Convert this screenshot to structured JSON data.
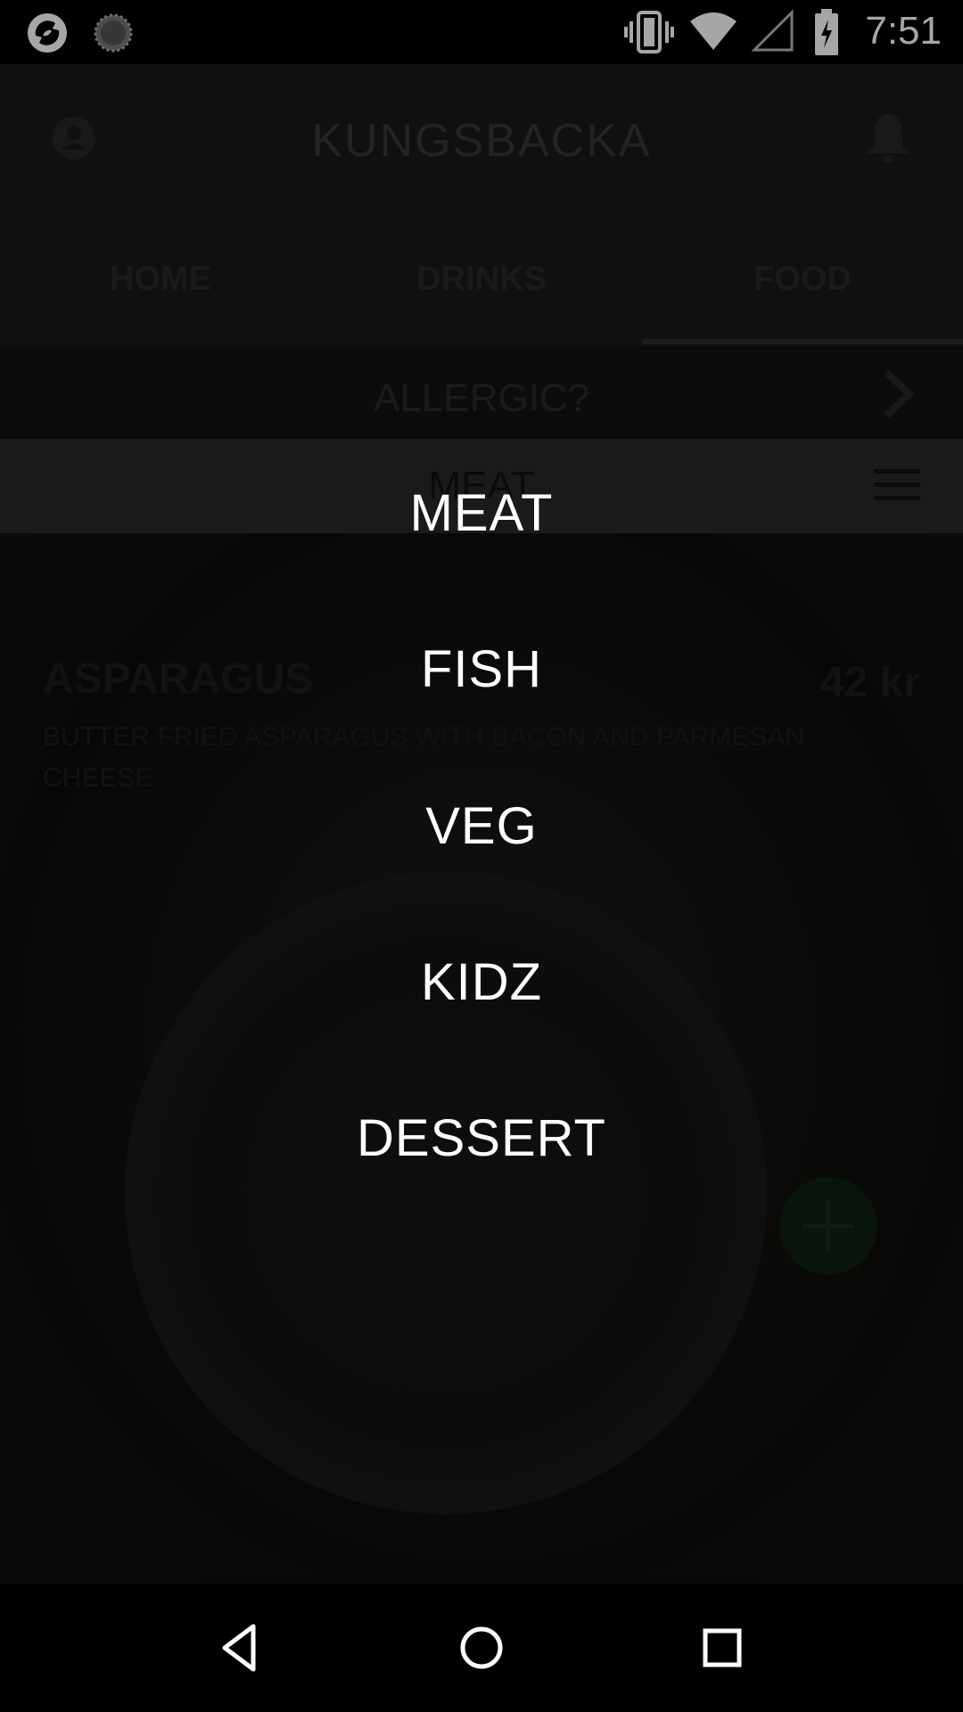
{
  "status_bar": {
    "time": "7:51",
    "icons": [
      "app-logo-icon",
      "loading-spinner-icon",
      "vibrate-icon",
      "wifi-icon",
      "cell-signal-icon",
      "battery-charging-icon"
    ]
  },
  "app": {
    "title": "KUNGSBACKA",
    "tabs": [
      {
        "label": "HOME"
      },
      {
        "label": "DRINKS"
      },
      {
        "label": "FOOD"
      }
    ],
    "active_tab": "FOOD",
    "allergic_label": "ALLERGIC?",
    "category_bar_label": "MEAT",
    "dish": {
      "name": "ASPARAGUS",
      "price": "42 kr",
      "description": "BUTTER FRIED ASPARAGUS WITH BACON AND PARMESAN CHEESE"
    }
  },
  "menu": {
    "items": [
      {
        "label": "MEAT"
      },
      {
        "label": "FISH"
      },
      {
        "label": "VEG"
      },
      {
        "label": "KIDZ"
      },
      {
        "label": "DESSERT"
      }
    ]
  },
  "nav_bar": {
    "icons": [
      "back-icon",
      "home-icon",
      "recents-icon"
    ]
  }
}
